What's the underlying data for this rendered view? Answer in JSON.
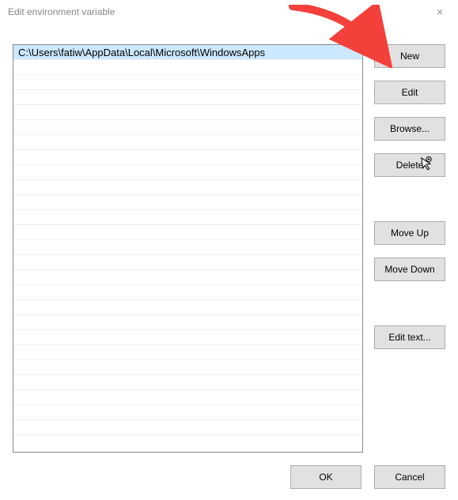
{
  "title": "Edit environment variable",
  "close_label": "×",
  "list": {
    "rows": [
      "C:\\Users\\fatiw\\AppData\\Local\\Microsoft\\WindowsApps",
      "",
      "",
      "",
      "",
      "",
      "",
      "",
      "",
      "",
      "",
      "",
      "",
      "",
      "",
      "",
      "",
      "",
      "",
      "",
      "",
      "",
      "",
      "",
      "",
      ""
    ],
    "selected_index": 0
  },
  "buttons": {
    "new": "New",
    "edit": "Edit",
    "browse": "Browse...",
    "delete": "Delete",
    "move_up": "Move Up",
    "move_down": "Move Down",
    "edit_text": "Edit text...",
    "ok": "OK",
    "cancel": "Cancel"
  },
  "annotation": {
    "arrow_color": "#f4403a"
  }
}
